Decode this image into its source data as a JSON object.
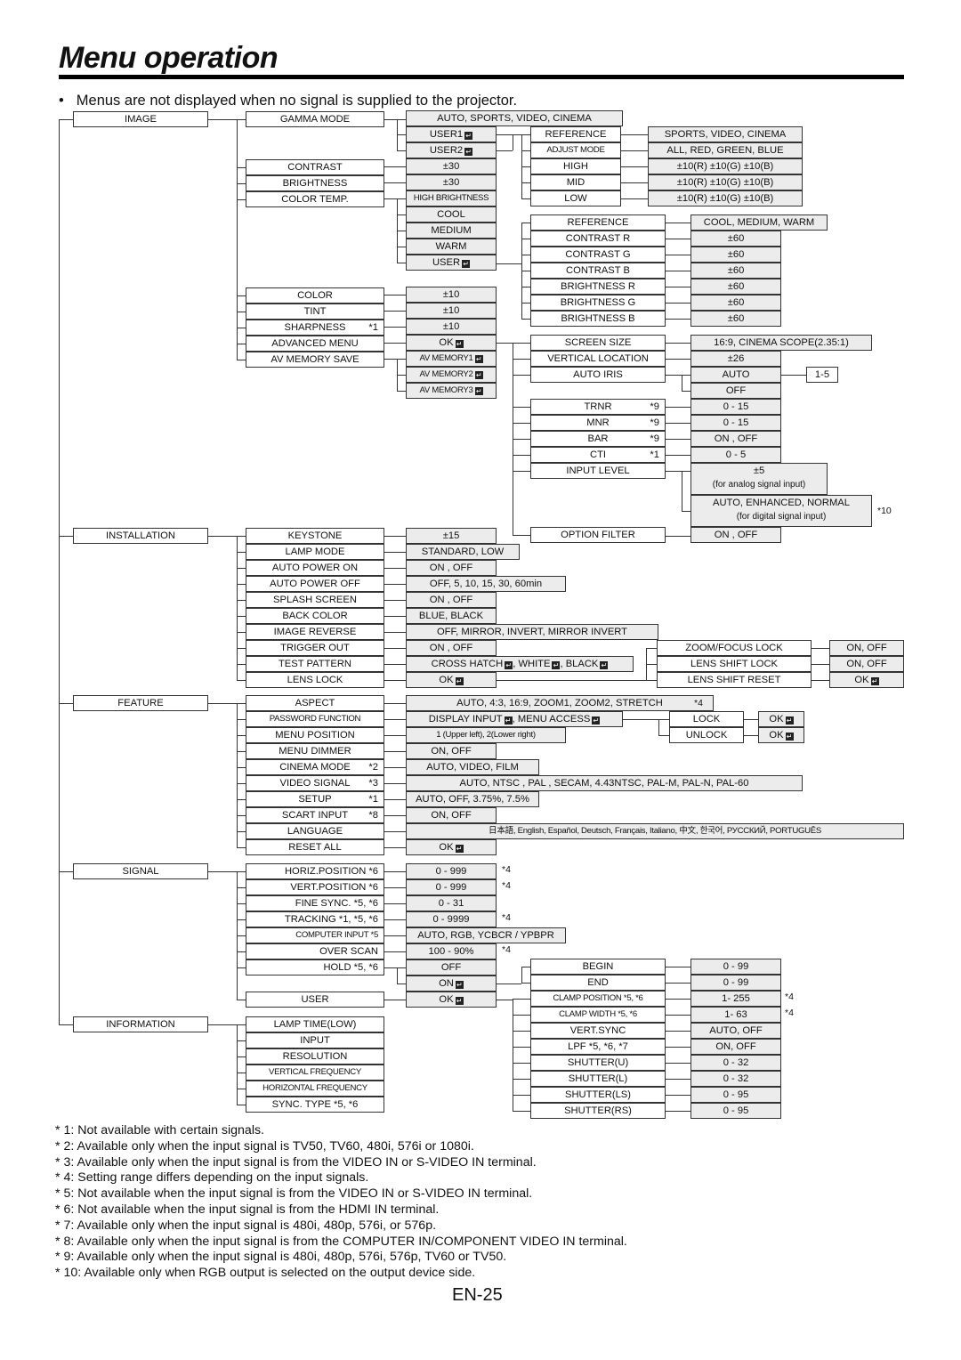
{
  "title": "Menu operation",
  "note": "Menus are not displayed when no signal is supplied to the projector.",
  "enter_icon": "enter-key-icon",
  "colors": {
    "value_box_bg": "#ececec",
    "item_box_bg": "#ffffff",
    "line": "#333333"
  },
  "menus": {
    "image": {
      "label": "IMAGE",
      "items": {
        "gamma_mode": "GAMMA MODE",
        "contrast": "CONTRAST",
        "brightness": "BRIGHTNESS",
        "color_temp": "COLOR TEMP.",
        "color": "COLOR",
        "tint": "TINT",
        "sharpness": "SHARPNESS",
        "sharpness_fn": "*1",
        "advanced_menu": "ADVANCED MENU",
        "av_memory_save": "AV MEMORY SAVE"
      },
      "values": {
        "gamma_modes": "AUTO, SPORTS, VIDEO, CINEMA",
        "user1": "USER1",
        "user2": "USER2",
        "contrast": "±30",
        "brightness": "±30",
        "high_brightness": "HIGH BRIGHTNESS",
        "cool": "COOL",
        "medium": "MEDIUM",
        "warm": "WARM",
        "user": "USER",
        "color": "±10",
        "tint": "±10",
        "sharpness": "±10",
        "advanced_ok": "OK",
        "av_memory1": "AV MEMORY1",
        "av_memory2": "AV MEMORY2",
        "av_memory3": "AV MEMORY3"
      },
      "gamma_user": {
        "reference": "REFERENCE",
        "adjust_mode": "ADJUST MODE",
        "high": "HIGH",
        "mid": "MID",
        "low": "LOW",
        "reference_val": "SPORTS, VIDEO, CINEMA",
        "adjust_mode_val": "ALL, RED, GREEN, BLUE",
        "high_val": "±10(R) ±10(G) ±10(B)",
        "mid_val": "±10(R) ±10(G) ±10(B)",
        "low_val": "±10(R) ±10(G) ±10(B)"
      },
      "color_temp_user": {
        "reference": "REFERENCE",
        "contrast_r": "CONTRAST R",
        "contrast_g": "CONTRAST G",
        "contrast_b": "CONTRAST B",
        "brightness_r": "BRIGHTNESS R",
        "brightness_g": "BRIGHTNESS G",
        "brightness_b": "BRIGHTNESS B",
        "reference_val": "COOL, MEDIUM, WARM",
        "v60": "±60"
      },
      "advanced": {
        "screen_size": "SCREEN SIZE",
        "vertical_location": "VERTICAL LOCATION",
        "auto_iris": "AUTO IRIS",
        "trnr": "TRNR",
        "mnr": "MNR",
        "bar": "BAR",
        "cti": "CTI",
        "fn9": "*9",
        "fn1": "*1",
        "input_level": "INPUT LEVEL",
        "option_filter": "OPTION FILTER",
        "screen_size_val": "16:9, CINEMA SCOPE(2.35:1)",
        "vertical_location_val": "±26",
        "auto": "AUTO",
        "off": "OFF",
        "iris_range": "1-5",
        "trnr_val": "0 - 15",
        "mnr_val": "0 - 15",
        "bar_val": "ON , OFF",
        "cti_val": "0 - 5",
        "input_level_analog": "±5",
        "input_level_analog_sub": "(for analog signal input)",
        "input_level_digital": "AUTO, ENHANCED, NORMAL",
        "input_level_digital_sub": "(for digital signal input)",
        "fn10": "*10",
        "option_filter_val": "ON , OFF"
      }
    },
    "installation": {
      "label": "INSTALLATION",
      "items": [
        "KEYSTONE",
        "LAMP MODE",
        "AUTO POWER ON",
        "AUTO POWER OFF",
        "SPLASH SCREEN",
        "BACK COLOR",
        "IMAGE REVERSE",
        "TRIGGER OUT",
        "TEST PATTERN",
        "LENS LOCK"
      ],
      "values": [
        "±15",
        "STANDARD, LOW",
        "ON , OFF",
        "OFF, 5, 10, 15, 30, 60min",
        "ON , OFF",
        "BLUE, BLACK",
        "OFF, MIRROR, INVERT, MIRROR INVERT",
        "ON , OFF",
        "CROSS HATCH, WHITE, BLACK",
        "OK"
      ],
      "test_pattern": {
        "cross_hatch": "CROSS HATCH",
        "white": "WHITE",
        "black": "BLACK"
      },
      "lens_lock": {
        "items": [
          "ZOOM/FOCUS LOCK",
          "LENS SHIFT LOCK",
          "LENS SHIFT RESET"
        ],
        "values": [
          "ON, OFF",
          "ON, OFF",
          "OK"
        ]
      }
    },
    "feature": {
      "label": "FEATURE",
      "items": [
        "ASPECT",
        "PASSWORD FUNCTION",
        "MENU POSITION",
        "MENU DIMMER",
        "CINEMA MODE",
        "VIDEO SIGNAL",
        "SETUP",
        "SCART INPUT",
        "LANGUAGE",
        "RESET ALL"
      ],
      "item_footnotes": [
        "",
        "",
        "",
        "",
        "*2",
        "*3",
        "*1",
        "*8",
        "",
        ""
      ],
      "values": [
        "AUTO, 4:3, 16:9, ZOOM1, ZOOM2, STRETCH",
        "DISPLAY INPUT, MENU ACCESS",
        "1 (Upper left), 2(Lower right)",
        "ON, OFF",
        "AUTO, VIDEO, FILM",
        "AUTO, NTSC , PAL , SECAM, 4.43NTSC, PAL-M, PAL-N, PAL-60",
        "AUTO, OFF, 3.75%, 7.5%",
        "ON, OFF",
        "日本語, English, Español, Deutsch, Français, Italiano, 中文, 한국어, РУССКИЙ, PORTUGUÊS",
        "OK"
      ],
      "aspect_fn": "*4",
      "password": {
        "display_input": "DISPLAY INPUT",
        "menu_access": "MENU ACCESS",
        "lock": "LOCK",
        "unlock": "UNLOCK",
        "ok": "OK"
      }
    },
    "signal": {
      "label": "SIGNAL",
      "items": [
        "HORIZ.POSITION",
        "VERT.POSITION",
        "FINE SYNC.",
        "TRACKING",
        "COMPUTER INPUT",
        "OVER SCAN",
        "HOLD",
        "USER"
      ],
      "item_footnotes": [
        "*6",
        "*6",
        "*5, *6",
        "*1, *5, *6",
        "*5",
        "",
        "*5, *6",
        ""
      ],
      "values": [
        "0 - 999",
        "0 - 999",
        "0 - 31",
        "0 - 9999",
        "AUTO, RGB, YCBCR / YPBPR",
        "100 - 90%",
        "OFF",
        "ON",
        "OK"
      ],
      "value_footnotes": [
        "*4",
        "*4",
        "",
        "*4",
        "",
        "*4"
      ],
      "user": {
        "items": [
          "BEGIN",
          "END",
          "CLAMP POSITION",
          "CLAMP WIDTH",
          "VERT.SYNC",
          "LPF",
          "SHUTTER(U)",
          "SHUTTER(L)",
          "SHUTTER(LS)",
          "SHUTTER(RS)"
        ],
        "item_footnotes": [
          "",
          "",
          "*5, *6",
          "*5, *6",
          "",
          "*5, *6, *7",
          "",
          "",
          "",
          ""
        ],
        "values": [
          "0 - 99",
          "0 - 99",
          "1- 255",
          "1- 63",
          "AUTO, OFF",
          "ON, OFF",
          "0 - 32",
          "0 - 32",
          "0 - 95",
          "0 - 95"
        ],
        "value_footnotes": [
          "",
          "",
          "*4",
          "*4",
          "",
          "",
          "",
          "",
          "",
          ""
        ]
      }
    },
    "information": {
      "label": "INFORMATION",
      "items": [
        "LAMP TIME(LOW)",
        "INPUT",
        "RESOLUTION",
        "VERTICAL FREQUENCY",
        "HORIZONTAL FREQUENCY",
        "SYNC. TYPE"
      ],
      "item_footnotes": [
        "",
        "",
        "",
        "",
        "",
        "*5, *6"
      ]
    }
  },
  "footnotes": [
    "* 1: Not available with certain signals.",
    "* 2: Available only when the input signal is TV50, TV60, 480i, 576i or 1080i.",
    "* 3: Available only when the input signal is from the VIDEO IN or S-VIDEO IN terminal.",
    "* 4: Setting range differs depending on the input signals.",
    "* 5: Not available when the input signal is from the VIDEO IN or S-VIDEO IN terminal.",
    "* 6: Not available when the input signal is from the HDMI IN terminal.",
    "* 7: Available only when the input signal is 480i, 480p, 576i, or 576p.",
    "* 8: Available only when the input signal is from the COMPUTER IN/COMPONENT VIDEO IN terminal.",
    "* 9: Available only when the input signal is 480i, 480p, 576i, 576p, TV60 or TV50.",
    "* 10: Available only when RGB output is selected on the output device side."
  ],
  "page_number": "EN-25"
}
